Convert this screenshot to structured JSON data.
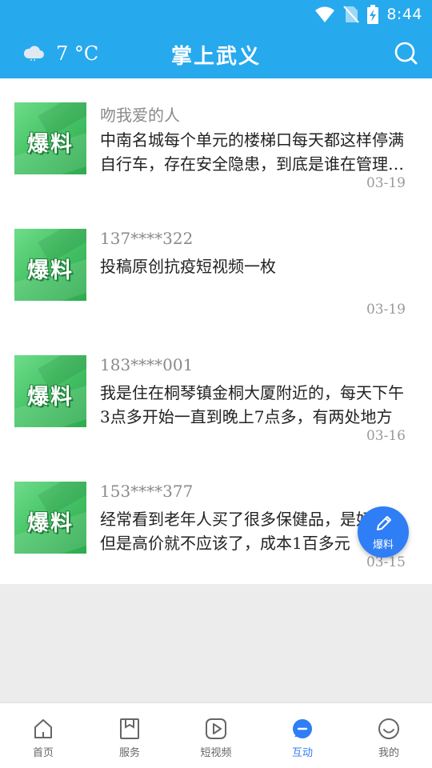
{
  "status_bar": {
    "time": "8:44"
  },
  "app_bar": {
    "weather_icon": "cloud-icon",
    "temperature": "7 °C",
    "title": "掌上武义",
    "search_icon": "search-icon"
  },
  "feed": [
    {
      "thumb_text": "爆料",
      "author": "吻我爱的人",
      "content": "中南名城每个单元的楼梯口每天都这样停满自行车，存在安全隐患，到底是谁在管理这件事情呢？",
      "date": "03-19"
    },
    {
      "thumb_text": "爆料",
      "author": "137****322",
      "content": "投稿原创抗疫短视频一枚",
      "date": "03-19"
    },
    {
      "thumb_text": "爆料",
      "author": "183****001",
      "content": "我是住在桐琴镇金桐大厦附近的，每天下午3点多开始一直到晚上7点多，有两处地方",
      "date": "03-16"
    },
    {
      "thumb_text": "爆料",
      "author": "153****377",
      "content": "经常看到老年人买了很多保健品，是好的，但是高价就不应该了，成本1百多元",
      "date": "03-15"
    }
  ],
  "fab": {
    "label": "爆料",
    "icon": "pencil-icon"
  },
  "bottom_nav": [
    {
      "label": "首页",
      "icon": "home-icon"
    },
    {
      "label": "服务",
      "icon": "bookmark-icon"
    },
    {
      "label": "短视频",
      "icon": "video-play-icon"
    },
    {
      "label": "互动",
      "icon": "chat-bubble-icon",
      "active": true
    },
    {
      "label": "我的",
      "icon": "smiley-icon"
    }
  ],
  "colors": {
    "primary": "#27a9ee",
    "accent": "#2f7ef5",
    "thumb_green": "#48c568"
  }
}
